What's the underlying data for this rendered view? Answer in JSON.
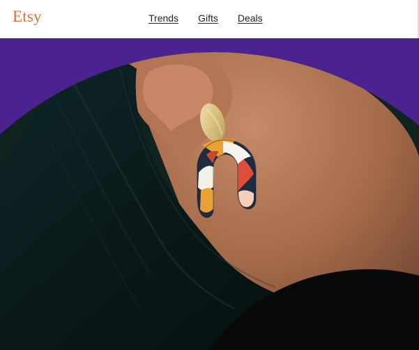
{
  "header": {
    "logo_text": "Etsy",
    "nav": [
      {
        "label": "Trends"
      },
      {
        "label": "Gifts"
      },
      {
        "label": "Deals"
      }
    ]
  },
  "hero": {
    "image": "earring-model-photo",
    "background_color": "#4a2391"
  },
  "colors": {
    "brand_orange": "#e26e35",
    "hero_purple": "#4a2391"
  }
}
